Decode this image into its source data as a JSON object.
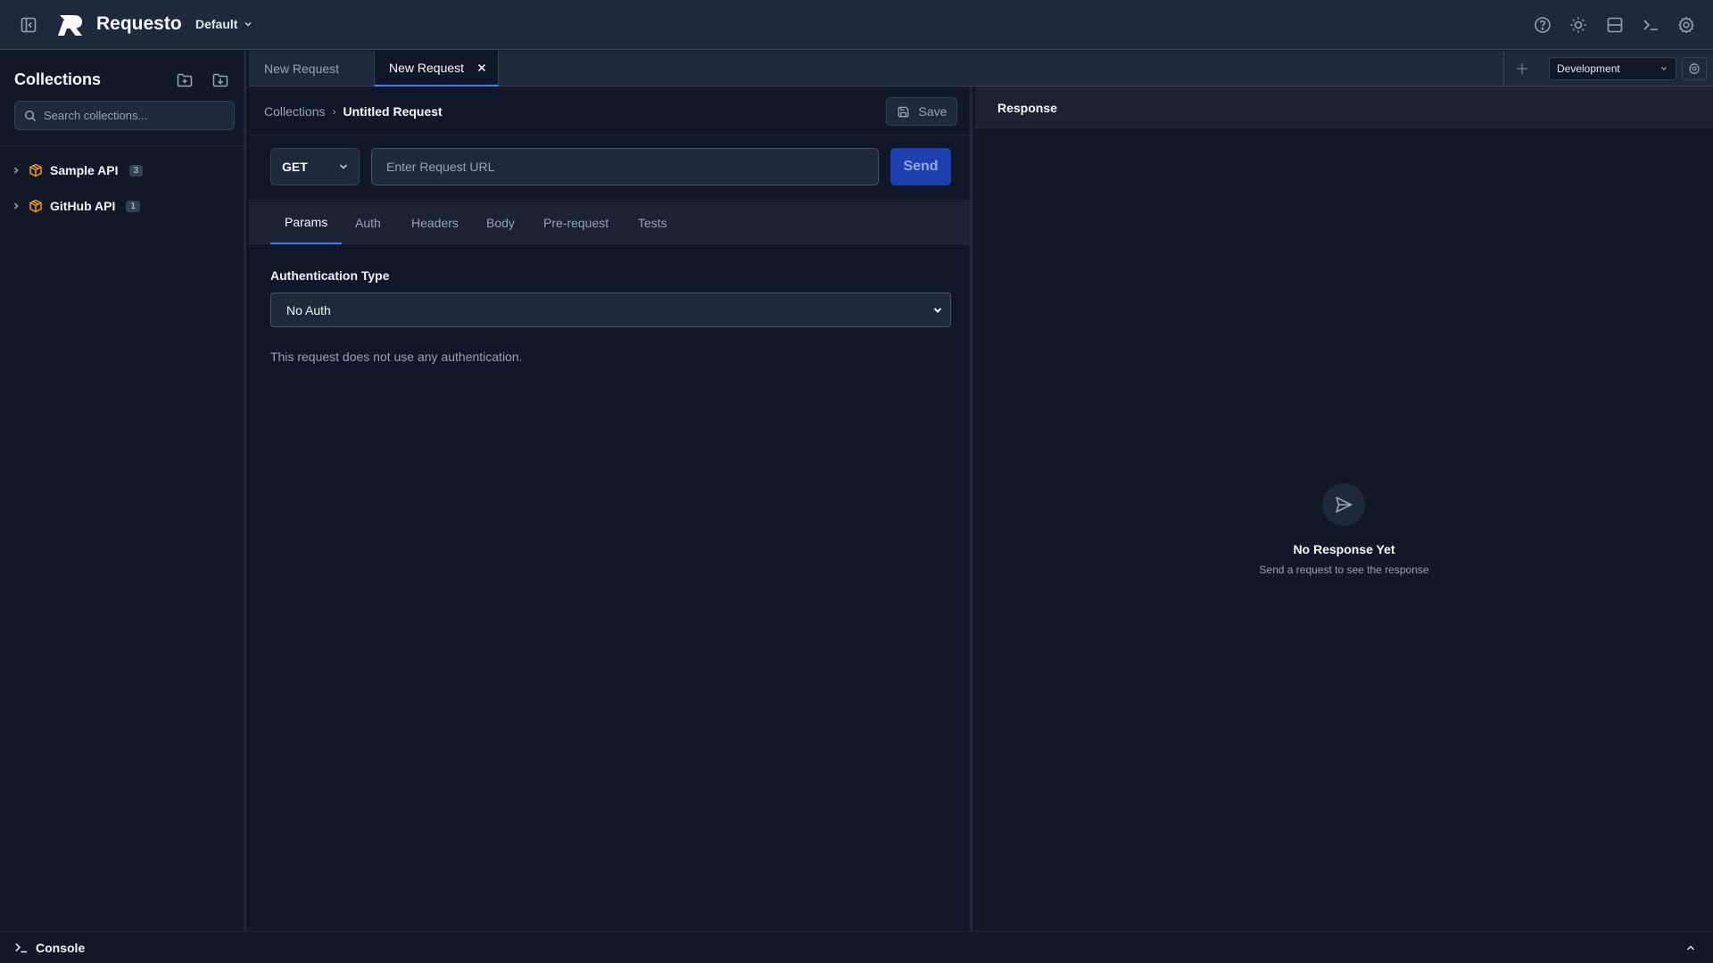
{
  "app": {
    "name": "Requesto",
    "workspace": "Default"
  },
  "topbar": {
    "icons": [
      "help-icon",
      "theme-sun-icon",
      "layout-icon",
      "terminal-icon",
      "settings-icon"
    ]
  },
  "sidebar": {
    "title": "Collections",
    "search_placeholder": "Search collections...",
    "collections": [
      {
        "name": "Sample API",
        "count": "3"
      },
      {
        "name": "GitHub API",
        "count": "1"
      }
    ]
  },
  "tabs": [
    {
      "label": "New Request",
      "active": false
    },
    {
      "label": "New Request",
      "active": true
    }
  ],
  "environment": {
    "selected": "Development"
  },
  "request": {
    "breadcrumb_root": "Collections",
    "breadcrumb_separator": "›",
    "breadcrumb_current": "Untitled Request",
    "save_label": "Save",
    "method": "GET",
    "url_value": "",
    "url_placeholder": "Enter Request URL",
    "send_label": "Send",
    "sub_tabs": [
      "Params",
      "Auth",
      "Headers",
      "Body",
      "Pre-request",
      "Tests"
    ],
    "active_sub_tab": "Params",
    "auth": {
      "label": "Authentication Type",
      "selected": "No Auth",
      "note": "This request does not use any authentication."
    }
  },
  "response": {
    "title": "Response",
    "empty_title": "No Response Yet",
    "empty_subtitle": "Send a request to see the response"
  },
  "console": {
    "label": "Console"
  },
  "colors": {
    "accent": "#3b82f6",
    "send_button": "#1e40af",
    "collection_icon": "#f59e0b",
    "background": "#0f1729",
    "panel": "#1e293b"
  }
}
